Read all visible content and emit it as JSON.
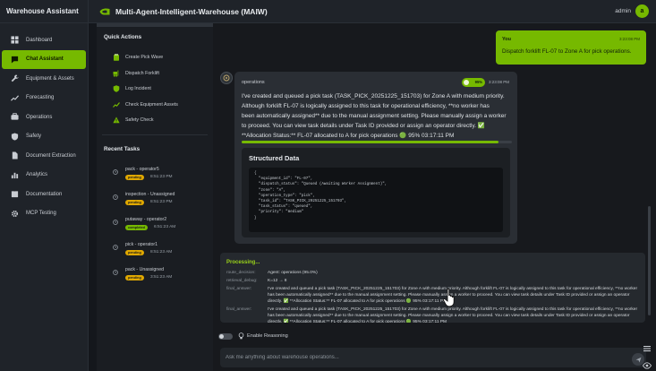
{
  "app": {
    "brand": "Warehouse Assistant",
    "title": "Multi-Agent-Intelligent-Warehouse (MAIW)",
    "user": "admin",
    "avatar_letter": "a",
    "accent": "#76b900"
  },
  "nav": [
    {
      "label": "Dashboard",
      "icon": "dashboard-icon"
    },
    {
      "label": "Chat Assistant",
      "icon": "chat-icon",
      "active": true
    },
    {
      "label": "Equipment & Assets",
      "icon": "wrench-icon"
    },
    {
      "label": "Forecasting",
      "icon": "trend-icon"
    },
    {
      "label": "Operations",
      "icon": "operations-icon"
    },
    {
      "label": "Safety",
      "icon": "shield-icon"
    },
    {
      "label": "Document Extraction",
      "icon": "document-icon"
    },
    {
      "label": "Analytics",
      "icon": "analytics-icon"
    },
    {
      "label": "Documentation",
      "icon": "book-icon"
    },
    {
      "label": "MCP Testing",
      "icon": "gear-icon"
    }
  ],
  "quick_actions": {
    "title": "Quick Actions",
    "items": [
      {
        "label": "Create Pick Wave",
        "icon": "clipboard-icon"
      },
      {
        "label": "Dispatch Forklift",
        "icon": "forklift-icon"
      },
      {
        "label": "Log Incident",
        "icon": "shield-icon"
      },
      {
        "label": "Check Equipment Assets",
        "icon": "trend-icon"
      },
      {
        "label": "Safety Check",
        "icon": "warning-icon"
      }
    ]
  },
  "recent_tasks": {
    "title": "Recent Tasks",
    "items": [
      {
        "name": "pack - operator5",
        "status": "pending",
        "time": "8:51:23 PM"
      },
      {
        "name": "inspection - Unassigned",
        "status": "pending",
        "time": "8:51:23 PM"
      },
      {
        "name": "putaway - operator2",
        "status": "completed",
        "time": "6:51:23 AM"
      },
      {
        "name": "pick - operator1",
        "status": "pending",
        "time": "8:51:23 AM"
      },
      {
        "name": "pack - Unassigned",
        "status": "pending",
        "time": "3:51:23 AM"
      }
    ]
  },
  "user_message": {
    "sender": "You",
    "time": "3:23:08 PM",
    "text": "Dispatch forklift FL-07 to Zone A for pick operations."
  },
  "bot_message": {
    "agent": "operations",
    "confidence": "95%",
    "time": "3:23:08 PM",
    "progress": 0.95,
    "lines": [
      "I've created and queued a pick task (TASK_PICK_20251225_151703) for Zone A with medium priority.",
      "Although forklift FL-07 is logically assigned to this task for operational efficiency, **no worker has",
      "been automatically assigned** due to the manual assignment setting. Please manually assign a worker",
      "to proceed. You can view task details under Task ID provided or assign an operator directly. ✅",
      "**Allocation Status:** FL-07 allocated to A for pick operations 🟢 95% 03:17:11 PM"
    ]
  },
  "structured_data": {
    "title": "Structured Data",
    "code": "{\n  \"equipment_id\": \"FL-07\",\n  \"dispatch_status\": \"Queued (Awaiting Worker Assignment)\",\n  \"zone\": \"A\",\n  \"operation_type\": \"pick\",\n  \"task_id\": \"TASK_PICK_20251225_151703\",\n  \"task_status\": \"queued\",\n  \"priority\": \"medium\"\n}"
  },
  "processing": {
    "title": "Processing...",
    "rows": [
      {
        "key": "route_decision:",
        "value": "Agent: operations (95.0%)"
      },
      {
        "key": "retrieval_debug:",
        "value": "K=12 → 8"
      },
      {
        "key": "final_answer:",
        "value": "I've created and queued a pick task (TASK_PICK_20251225_151703) for Zone A with medium priority. Although forklift FL-07 is logically assigned to this task for operational efficiency, **no worker has been automatically assigned** due to the manual assignment setting. Please manually assign a worker to proceed. You can view task details under Task ID provided or assign an operator directly. ✅ **Allocation Status:** FL-07 allocated to A for pick operations 🟢 95% 03:17:11 PM"
      },
      {
        "key": "final_answer:",
        "value": "I've created and queued a pick task (TASK_PICK_20251225_151703) for Zone A with medium priority. Although forklift FL-07 is logically assigned to this task for operational efficiency, **no worker has been automatically assigned** due to the manual assignment setting. Please manually assign a worker to proceed. You can view task details under Task ID provided or assign an operator directly. ✅ **Allocation Status:** FL-07 allocated to A for pick operations 🟢 95% 03:17:11 PM"
      }
    ]
  },
  "composer": {
    "toggle_label": "Enable Reasoning",
    "placeholder": "Ask me anything about warehouse operations..."
  }
}
